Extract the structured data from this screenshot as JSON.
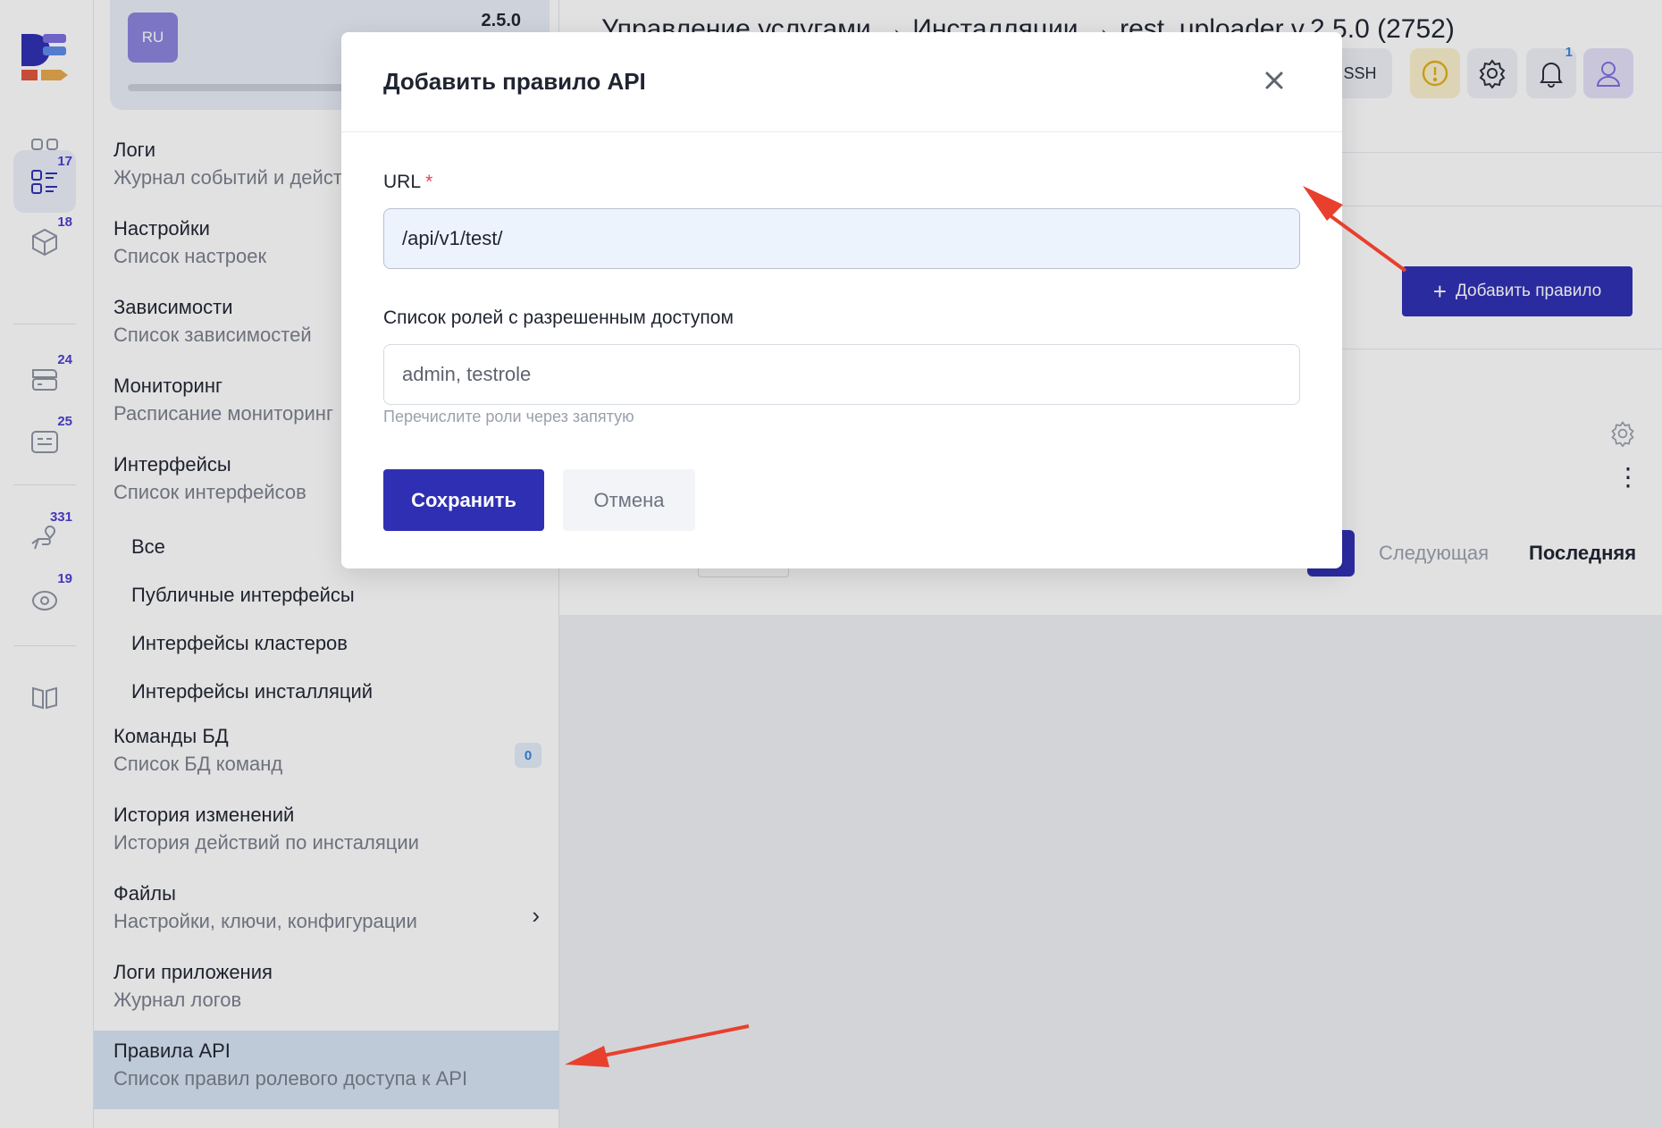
{
  "rail": {
    "items": [
      {
        "icon": "apps-grid-icon",
        "badge": ""
      },
      {
        "icon": "services-list-icon",
        "badge": "17"
      },
      {
        "icon": "cube-icon",
        "badge": "18"
      },
      {
        "icon": "server-icon",
        "badge": "24"
      },
      {
        "icon": "terminal-icon",
        "badge": "25"
      },
      {
        "icon": "hand-support-icon",
        "badge": "331"
      },
      {
        "icon": "eye-monitor-icon",
        "badge": "19"
      },
      {
        "icon": "book-icon",
        "badge": ""
      }
    ]
  },
  "instance": {
    "avatar": "RU",
    "version": "2.5.0"
  },
  "menu": {
    "logs": {
      "title": "Логи",
      "sub": "Журнал событий и дейст"
    },
    "settings": {
      "title": "Настройки",
      "sub": "Список настроек"
    },
    "deps": {
      "title": "Зависимости",
      "sub": "Список зависимостей"
    },
    "monitoring": {
      "title": "Мониторинг",
      "sub": "Расписание мониторинг"
    },
    "interfaces": {
      "title": "Интерфейсы",
      "sub": "Список интерфейсов"
    },
    "if_all": "Все",
    "if_public": "Публичные интерфейсы",
    "if_clusters": "Интерфейсы кластеров",
    "if_installs": "Интерфейсы инсталляций",
    "db": {
      "title": "Команды БД",
      "sub": "Список БД команд",
      "count": "0"
    },
    "history": {
      "title": "История изменений",
      "sub": "История действий по инсталяции"
    },
    "files": {
      "title": "Файлы",
      "sub": "Настройки, ключи, конфигурации"
    },
    "applogs": {
      "title": "Логи приложения",
      "sub": "Журнал логов"
    },
    "api": {
      "title": "Правила API",
      "sub": "Список правил ролевого доступа к API"
    }
  },
  "header": {
    "breadcrumb": "Управление услугами → Инсталляции → rest_uploader v.2.5.0 (2752)",
    "ssh_label": "SSH",
    "notifications_count": "1"
  },
  "page": {
    "add_rule_label": "Добавить правило",
    "pagination_next": "Следующая",
    "pagination_last": "Последняя"
  },
  "modal": {
    "title": "Добавить правило API",
    "url_label": "URL",
    "url_required_mark": "*",
    "url_value": "/api/v1/test/",
    "roles_label": "Список ролей с разрешенным доступом",
    "roles_placeholder": "admin, testrole",
    "roles_hint": "Перечислите роли через запятую",
    "save_label": "Сохранить",
    "cancel_label": "Отмена"
  },
  "colors": {
    "accent": "#2f2fb4",
    "selected_item": "#d7e5f3",
    "annotation_arrow": "#e8402d"
  }
}
